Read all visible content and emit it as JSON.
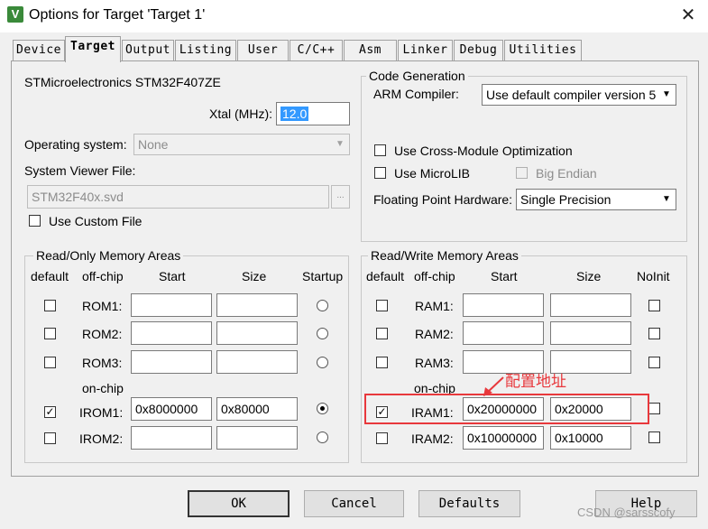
{
  "window": {
    "title": "Options for Target 'Target 1'",
    "close_glyph": "✕",
    "icon_letter": "V"
  },
  "tabs": [
    "Device",
    "Target",
    "Output",
    "Listing",
    "User",
    "C/C++",
    "Asm",
    "Linker",
    "Debug",
    "Utilities"
  ],
  "active_tab": "Target",
  "device": {
    "name": "STMicroelectronics STM32F407ZE",
    "xtal_label": "Xtal (MHz):",
    "xtal_value": "12.0",
    "os_label": "Operating system:",
    "os_value": "None",
    "svd_label": "System Viewer File:",
    "svd_value": "STM32F40x.svd",
    "browse_label": "...",
    "custom_file_label": "Use Custom File"
  },
  "code_gen": {
    "title": "Code Generation",
    "compiler_label": "ARM Compiler:",
    "compiler_value": "Use default compiler version 5",
    "cross_module_label": "Use Cross-Module Optimization",
    "microlib_label": "Use MicroLIB",
    "big_endian_label": "Big Endian",
    "fpu_label": "Floating Point Hardware:",
    "fpu_value": "Single Precision"
  },
  "ro_mem": {
    "title": "Read/Only Memory Areas",
    "headers": {
      "default": "default",
      "offchip": "off-chip",
      "start": "Start",
      "size": "Size",
      "startup": "Startup"
    },
    "onchip_label": "on-chip",
    "rows": [
      {
        "name": "ROM1:",
        "start": "",
        "size": "",
        "checked": false,
        "startup": false
      },
      {
        "name": "ROM2:",
        "start": "",
        "size": "",
        "checked": false,
        "startup": false
      },
      {
        "name": "ROM3:",
        "start": "",
        "size": "",
        "checked": false,
        "startup": false
      },
      {
        "name": "IROM1:",
        "start": "0x8000000",
        "size": "0x80000",
        "checked": true,
        "startup": true
      },
      {
        "name": "IROM2:",
        "start": "",
        "size": "",
        "checked": false,
        "startup": false
      }
    ]
  },
  "rw_mem": {
    "title": "Read/Write Memory Areas",
    "headers": {
      "default": "default",
      "offchip": "off-chip",
      "start": "Start",
      "size": "Size",
      "noinit": "NoInit"
    },
    "onchip_label": "on-chip",
    "rows": [
      {
        "name": "RAM1:",
        "start": "",
        "size": "",
        "checked": false,
        "noinit": false
      },
      {
        "name": "RAM2:",
        "start": "",
        "size": "",
        "checked": false,
        "noinit": false
      },
      {
        "name": "RAM3:",
        "start": "",
        "size": "",
        "checked": false,
        "noinit": false
      },
      {
        "name": "IRAM1:",
        "start": "0x20000000",
        "size": "0x20000",
        "checked": true,
        "noinit": false
      },
      {
        "name": "IRAM2:",
        "start": "0x10000000",
        "size": "0x10000",
        "checked": false,
        "noinit": false
      }
    ]
  },
  "annotation": {
    "text": "配置地址",
    "color": "#e8383c"
  },
  "buttons": {
    "ok": "OK",
    "cancel": "Cancel",
    "defaults": "Defaults",
    "help": "Help"
  },
  "watermark": "CSDN @sarsscofy",
  "colors": {
    "selection": "#3399ff",
    "highlight_box": "#e8383c",
    "dialog_bg": "#f0f0f0"
  }
}
